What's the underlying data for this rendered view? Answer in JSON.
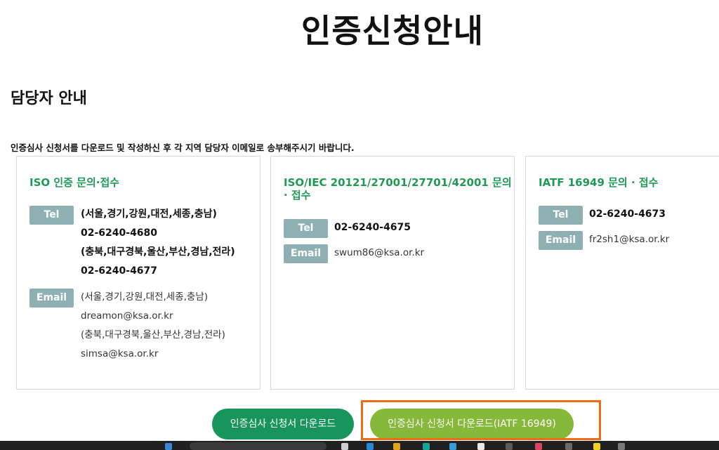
{
  "page": {
    "title": "인증신청안내",
    "section_title": "담당자 안내",
    "instruction": "인증심사 신청서를 다운로드 및 작성하신 후 각 지역 담당자 이메일로 송부해주시기 바랍니다."
  },
  "cards": [
    {
      "title": "ISO 인증 문의·접수",
      "tel_label": "Tel",
      "tel_lines": [
        "(서울,경기,강원,대전,세종,충남)",
        "02-6240-4680",
        "(충북,대구경북,울산,부산,경남,전라)",
        "02-6240-4677"
      ],
      "email_label": "Email",
      "email_lines": [
        "(서울,경기,강원,대전,세종,충남)",
        "dreamon@ksa.or.kr",
        "(충북,대구경북,울산,부산,경남,전라)",
        "simsa@ksa.or.kr"
      ]
    },
    {
      "title_line1": "ISO/IEC 20121/27001/27701/42001 문의",
      "title_line2": "· 접수",
      "tel_label": "Tel",
      "tel": "02-6240-4675",
      "email_label": "Email",
      "email": "swum86@ksa.or.kr"
    },
    {
      "title": "IATF 16949 문의 · 접수",
      "tel_label": "Tel",
      "tel": "02-6240-4673",
      "email_label": "Email",
      "email": "fr2sh1@ksa.or.kr"
    }
  ],
  "buttons": {
    "download": "인증심사 신청서 다운로드",
    "download_iatf": "인증심사 신청서 다운로드(IATF 16949)"
  },
  "colors": {
    "title_green": "#1f9a54",
    "badge": "#8fb0b2",
    "button_green": "#17955a",
    "button_lime": "#86b83a",
    "highlight": "#f26a13"
  }
}
